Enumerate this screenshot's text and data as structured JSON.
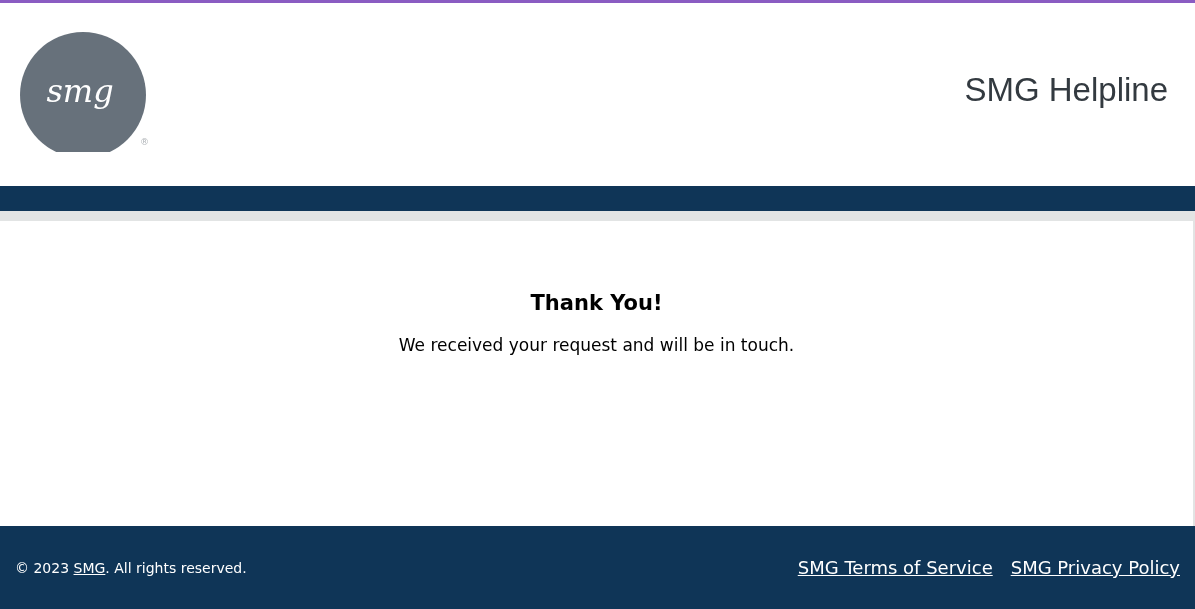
{
  "header": {
    "logo": {
      "text": "smg",
      "registered_mark": "®"
    },
    "title": "SMG Helpline"
  },
  "message": {
    "heading": "Thank You!",
    "body": "We received your request and will be in touch."
  },
  "footer": {
    "copyright": {
      "prefix": "© 2023 ",
      "link": "SMG",
      "suffix": ". All rights reserved."
    },
    "links": [
      "SMG Terms of Service",
      "SMG Privacy Policy"
    ]
  }
}
